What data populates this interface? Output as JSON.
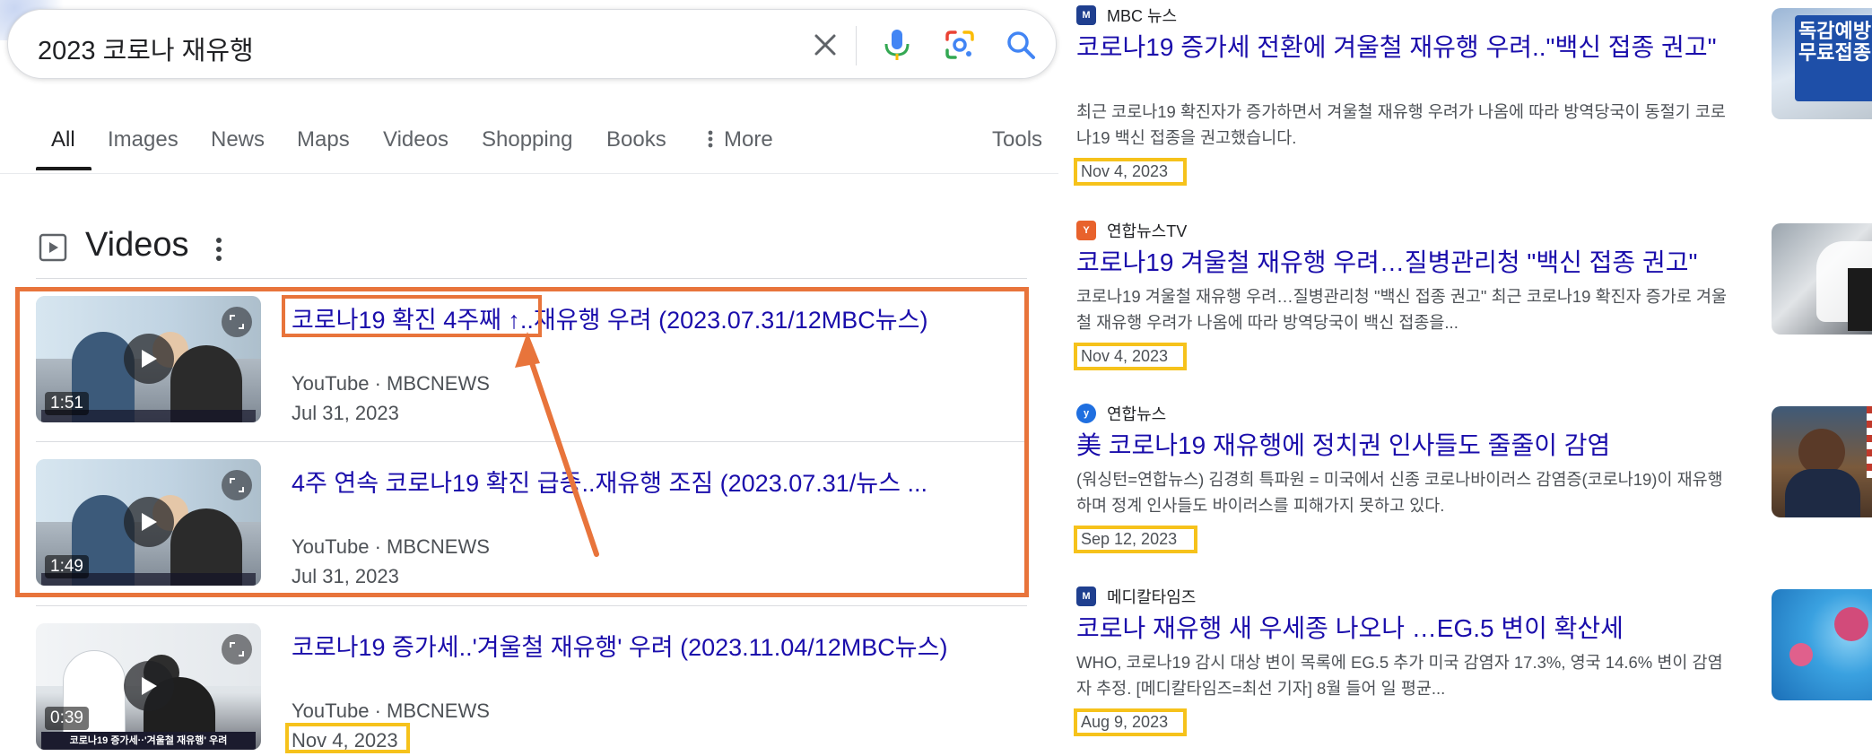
{
  "search": {
    "query": "2023 코로나 재유행"
  },
  "tabs": [
    "All",
    "Images",
    "News",
    "Maps",
    "Videos",
    "Shopping",
    "Books",
    "More",
    "Tools"
  ],
  "videos_section": {
    "heading": "Videos",
    "items": [
      {
        "title": "코로나19 확진 4주째 ↑..재유행 우려 (2023.07.31/12MBC뉴스)",
        "source": "YouTube · MBCNEWS",
        "date": "Jul 31, 2023",
        "duration": "1:51"
      },
      {
        "title": "4주 연속 코로나19 확진 급증..재유행 조짐 (2023.07.31/뉴스 ...",
        "source": "YouTube · MBCNEWS",
        "date": "Jul 31, 2023",
        "duration": "1:49"
      },
      {
        "title": "코로나19 증가세..'겨울철 재유행' 우려 (2023.11.04/12MBC뉴스)",
        "source": "YouTube · MBCNEWS",
        "date": "Nov 4, 2023",
        "duration": "0:39",
        "thumb_caption": "코로나19 증가세··'겨울철 재유행' 우려"
      }
    ]
  },
  "news": [
    {
      "source": "MBC 뉴스",
      "title": "코로나19 증가세 전환에 겨울철 재유행 우려..\"백신 접종 권고\"",
      "snippet": "최근 코로나19 확진자가 증가하면서 겨울철 재유행 우려가 나옴에 따라 방역당국이 동절기 코로나19 백신 접종을 권고했습니다.",
      "date": "Nov 4, 2023",
      "favicon_color": "#1f3f8f",
      "thumb_text": "독감예방 무료접종"
    },
    {
      "source": "연합뉴스TV",
      "title": "코로나19 겨울철 재유행 우려…질병관리청 \"백신 접종 권고\"",
      "snippet": "코로나19 겨울철 재유행 우려…질병관리청 \"백신 접종 권고\" 최근 코로나19 확진자 증가로 겨울철 재유행 우려가 나옴에 따라 방역당국이 백신 접종을...",
      "date": "Nov 4, 2023",
      "favicon_color": "#e8622c"
    },
    {
      "source": "연합뉴스",
      "title": "美 코로나19 재유행에 정치권 인사들도 줄줄이 감염",
      "snippet": "(워싱턴=연합뉴스) 김경희 특파원 = 미국에서 신종 코로나바이러스 감염증(코로나19)이 재유행하며 정계 인사들도 바이러스를 피해가지 못하고 있다.",
      "date": "Sep 12, 2023",
      "favicon_color": "#1f6fe0"
    },
    {
      "source": "메디칼타임즈",
      "title": "코로나 재유행 새 우세종 나오나 …EG.5 변이 확산세",
      "snippet": "WHO, 코로나19 감시 대상 변이 목록에 EG.5 추가 미국 감염자 17.3%, 영국 14.6% 변이 감염자 추정. [메디칼타임즈=최선 기자] 8월 들어 일 평균...",
      "date": "Aug 9, 2023",
      "favicon_color": "#1f3f8f"
    }
  ],
  "colors": {
    "link": "#1a0dab",
    "annotation_orange": "#e8743b",
    "annotation_yellow": "#f6c21b"
  }
}
